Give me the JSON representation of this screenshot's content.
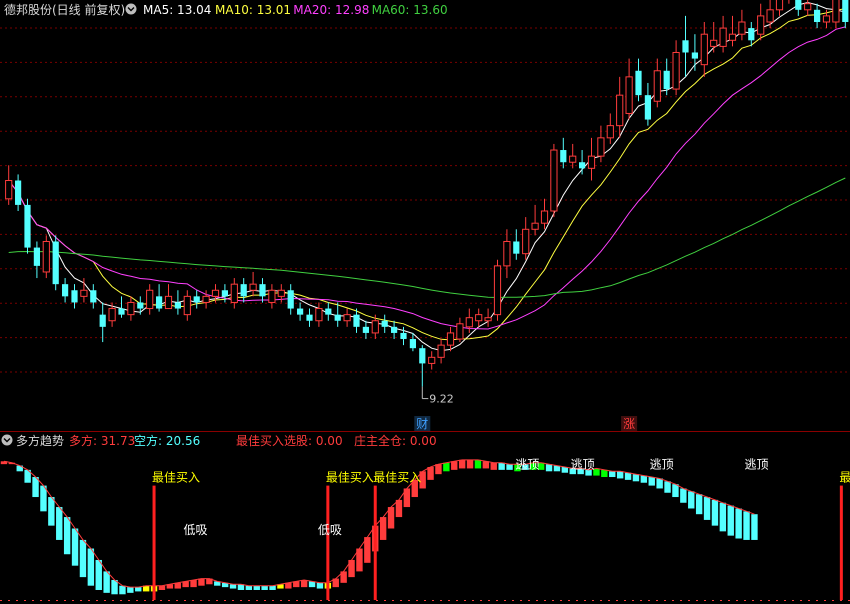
{
  "colors": {
    "bg": "#000000",
    "grid": "#7a0000",
    "up": "#ff3c3c",
    "down": "#54ffff",
    "ma5": "#ffffff",
    "ma10": "#ffff40",
    "ma20": "#ff40ff",
    "ma60": "#40d040",
    "header_text": "#d8d8d8",
    "yellow": "#ffff00",
    "green": "#00ff00"
  },
  "chart_data": [
    {
      "type": "candlestick",
      "panel": "price",
      "title": "德邦股份(日线 前复权)",
      "ma_labels": [
        {
          "name": "MA5",
          "text": "MA5: 13.04",
          "color": "#ffffff"
        },
        {
          "name": "MA10",
          "text": "MA10: 13.01",
          "color": "#ffff40"
        },
        {
          "name": "MA20",
          "text": "MA20: 12.98",
          "color": "#ff40ff"
        },
        {
          "name": "MA60",
          "text": "MA60: 13.60",
          "color": "#40d040"
        }
      ],
      "grid": true,
      "ylim": [
        9.0,
        15.2
      ],
      "low_annotation": "9.22",
      "markers": [
        {
          "text": "财",
          "index": 44,
          "color": "#3fa0ff"
        },
        {
          "text": "涨",
          "index": 66,
          "color": "#ff3c3c"
        }
      ],
      "candles": [
        [
          12.3,
          12.6,
          12.85,
          12.2
        ],
        [
          12.6,
          12.2,
          12.7,
          12.1
        ],
        [
          12.2,
          11.5,
          12.3,
          11.4
        ],
        [
          11.5,
          11.2,
          11.6,
          11.0
        ],
        [
          11.1,
          11.6,
          11.7,
          11.0
        ],
        [
          11.6,
          10.9,
          11.7,
          10.8
        ],
        [
          10.9,
          10.7,
          11.0,
          10.6
        ],
        [
          10.8,
          10.6,
          10.9,
          10.5
        ],
        [
          10.7,
          10.8,
          11.0,
          10.6
        ],
        [
          10.8,
          10.6,
          10.9,
          10.5
        ],
        [
          10.4,
          10.2,
          10.6,
          9.95
        ],
        [
          10.3,
          10.5,
          10.6,
          10.2
        ],
        [
          10.5,
          10.4,
          10.7,
          10.35
        ],
        [
          10.4,
          10.6,
          10.7,
          10.3
        ],
        [
          10.6,
          10.5,
          10.7,
          10.4
        ],
        [
          10.5,
          10.8,
          10.9,
          10.4
        ],
        [
          10.7,
          10.5,
          10.9,
          10.45
        ],
        [
          10.5,
          10.7,
          10.9,
          10.5
        ],
        [
          10.6,
          10.5,
          10.8,
          10.4
        ],
        [
          10.4,
          10.7,
          10.8,
          10.3
        ],
        [
          10.7,
          10.6,
          10.8,
          10.5
        ],
        [
          10.6,
          10.7,
          10.8,
          10.5
        ],
        [
          10.7,
          10.8,
          10.9,
          10.6
        ],
        [
          10.8,
          10.7,
          10.9,
          10.6
        ],
        [
          10.6,
          10.9,
          11.0,
          10.5
        ],
        [
          10.9,
          10.7,
          11.0,
          10.6
        ],
        [
          10.8,
          10.9,
          11.1,
          10.7
        ],
        [
          10.9,
          10.7,
          11.0,
          10.6
        ],
        [
          10.6,
          10.8,
          10.9,
          10.5
        ],
        [
          10.7,
          10.8,
          10.9,
          10.6
        ],
        [
          10.8,
          10.5,
          10.9,
          10.4
        ],
        [
          10.5,
          10.4,
          10.6,
          10.3
        ],
        [
          10.4,
          10.3,
          10.5,
          10.2
        ],
        [
          10.3,
          10.5,
          10.6,
          10.2
        ],
        [
          10.5,
          10.4,
          10.6,
          10.3
        ],
        [
          10.4,
          10.3,
          10.6,
          10.2
        ],
        [
          10.3,
          10.4,
          10.5,
          10.2
        ],
        [
          10.4,
          10.2,
          10.5,
          10.1
        ],
        [
          10.2,
          10.1,
          10.3,
          10.0
        ],
        [
          10.1,
          10.3,
          10.4,
          10.0
        ],
        [
          10.3,
          10.2,
          10.4,
          10.1
        ],
        [
          10.2,
          10.1,
          10.3,
          10.0
        ],
        [
          10.1,
          10.0,
          10.2,
          9.9
        ],
        [
          10.0,
          9.85,
          10.1,
          9.8
        ],
        [
          9.85,
          9.6,
          9.9,
          9.22
        ],
        [
          9.6,
          9.7,
          9.8,
          9.5
        ],
        [
          9.7,
          9.9,
          10.0,
          9.6
        ],
        [
          9.9,
          10.1,
          10.2,
          9.8
        ],
        [
          10.0,
          10.25,
          10.35,
          9.95
        ],
        [
          10.2,
          10.35,
          10.5,
          10.1
        ],
        [
          10.3,
          10.4,
          10.5,
          10.2
        ],
        [
          10.3,
          10.35,
          10.5,
          10.2
        ],
        [
          10.4,
          11.2,
          11.3,
          10.3
        ],
        [
          11.2,
          11.6,
          11.8,
          11.0
        ],
        [
          11.6,
          11.4,
          11.8,
          11.3
        ],
        [
          11.4,
          11.8,
          12.0,
          11.3
        ],
        [
          11.8,
          11.9,
          12.2,
          11.7
        ],
        [
          11.9,
          12.1,
          12.3,
          11.8
        ],
        [
          12.1,
          13.1,
          13.2,
          12.0
        ],
        [
          13.1,
          12.9,
          13.3,
          12.8
        ],
        [
          12.9,
          13.0,
          13.2,
          12.8
        ],
        [
          12.9,
          12.8,
          13.1,
          12.7
        ],
        [
          12.8,
          13.0,
          13.3,
          12.6
        ],
        [
          13.0,
          13.3,
          13.5,
          12.9
        ],
        [
          13.3,
          13.5,
          13.7,
          13.2
        ],
        [
          13.5,
          14.0,
          14.3,
          13.3
        ],
        [
          13.7,
          14.3,
          14.6,
          13.6
        ],
        [
          14.4,
          14.0,
          14.6,
          13.9
        ],
        [
          14.0,
          13.6,
          14.2,
          13.5
        ],
        [
          13.9,
          14.4,
          14.6,
          13.8
        ],
        [
          14.4,
          14.1,
          14.6,
          14.0
        ],
        [
          14.1,
          14.7,
          14.9,
          14.0
        ],
        [
          14.9,
          14.7,
          15.3,
          14.3
        ],
        [
          14.7,
          14.6,
          15.0,
          14.4
        ],
        [
          14.5,
          15.0,
          15.2,
          14.3
        ],
        [
          14.8,
          14.9,
          15.2,
          14.7
        ],
        [
          14.8,
          15.1,
          15.3,
          14.7
        ],
        [
          14.9,
          15.0,
          15.3,
          14.8
        ],
        [
          15.0,
          15.2,
          15.4,
          14.9
        ],
        [
          15.1,
          14.9,
          15.2,
          14.8
        ],
        [
          15.0,
          15.3,
          15.5,
          14.9
        ],
        [
          15.2,
          15.4,
          15.7,
          15.1
        ],
        [
          15.4,
          15.6,
          15.8,
          15.3
        ],
        [
          15.6,
          15.7,
          15.9,
          15.5
        ],
        [
          15.7,
          15.4,
          15.8,
          15.3
        ],
        [
          15.4,
          15.5,
          15.7,
          15.3
        ],
        [
          15.4,
          15.2,
          15.5,
          15.1
        ],
        [
          15.2,
          15.3,
          15.4,
          15.1
        ],
        [
          15.2,
          15.6,
          15.7,
          15.1
        ],
        [
          15.6,
          15.2,
          15.7,
          15.1
        ]
      ]
    },
    {
      "type": "bar",
      "panel": "indicator",
      "title": "多方趋势",
      "labels": [
        {
          "name": "多方",
          "text": "多方: 31.73",
          "color": "#ff3c3c"
        },
        {
          "name": "空方",
          "text": "空方: 20.56",
          "color": "#54ffff"
        },
        {
          "name": "最佳买入选股",
          "text": "最佳买入选股: 0.00",
          "color": "#ff3c3c"
        },
        {
          "name": "庄主全仓",
          "text": "庄主全仓: 0.00",
          "color": "#ff3c3c"
        }
      ],
      "ylim": [
        0,
        100
      ],
      "bars": [
        [
          95,
          97,
          "up"
        ],
        [
          95,
          96,
          "up"
        ],
        [
          90,
          94,
          "down"
        ],
        [
          82,
          91,
          "down"
        ],
        [
          72,
          86,
          "down"
        ],
        [
          62,
          80,
          "down"
        ],
        [
          52,
          72,
          "down"
        ],
        [
          42,
          65,
          "down"
        ],
        [
          32,
          58,
          "down"
        ],
        [
          24,
          50,
          "down"
        ],
        [
          16,
          42,
          "down"
        ],
        [
          10,
          36,
          "down"
        ],
        [
          7,
          28,
          "down"
        ],
        [
          5,
          20,
          "down"
        ],
        [
          4,
          14,
          "down"
        ],
        [
          4,
          10,
          "down"
        ],
        [
          5,
          9,
          "down"
        ],
        [
          6,
          9,
          "down"
        ],
        [
          6,
          10,
          "yellow"
        ],
        [
          6,
          10,
          "yellow"
        ],
        [
          7,
          10,
          "up"
        ],
        [
          8,
          11,
          "up"
        ],
        [
          8,
          12,
          "up"
        ],
        [
          9,
          13,
          "up"
        ],
        [
          9,
          14,
          "up"
        ],
        [
          10,
          15,
          "up"
        ],
        [
          11,
          15,
          "up"
        ],
        [
          10,
          13,
          "down"
        ],
        [
          9,
          12,
          "down"
        ],
        [
          8,
          11,
          "down"
        ],
        [
          7,
          11,
          "down"
        ],
        [
          7,
          10,
          "down"
        ],
        [
          7,
          10,
          "down"
        ],
        [
          7,
          10,
          "down"
        ],
        [
          7,
          10,
          "down"
        ],
        [
          8,
          11,
          "yellow"
        ],
        [
          8,
          12,
          "up"
        ],
        [
          9,
          13,
          "up"
        ],
        [
          9,
          14,
          "up"
        ],
        [
          9,
          13,
          "down"
        ],
        [
          8,
          12,
          "down"
        ],
        [
          8,
          12,
          "yellow"
        ],
        [
          9,
          15,
          "up"
        ],
        [
          12,
          20,
          "up"
        ],
        [
          16,
          28,
          "up"
        ],
        [
          20,
          36,
          "up"
        ],
        [
          26,
          44,
          "up"
        ],
        [
          34,
          52,
          "up"
        ],
        [
          42,
          58,
          "up"
        ],
        [
          50,
          65,
          "up"
        ],
        [
          58,
          70,
          "up"
        ],
        [
          65,
          78,
          "up"
        ],
        [
          72,
          84,
          "up"
        ],
        [
          78,
          90,
          "up"
        ],
        [
          84,
          93,
          "up"
        ],
        [
          88,
          95,
          "up"
        ],
        [
          90,
          96,
          "green"
        ],
        [
          91,
          97,
          "up"
        ],
        [
          92,
          98,
          "up"
        ],
        [
          92,
          98,
          "up"
        ],
        [
          92,
          98,
          "green"
        ],
        [
          92,
          97,
          "up"
        ],
        [
          91,
          96,
          "up"
        ],
        [
          91,
          96,
          "down"
        ],
        [
          91,
          95,
          "down"
        ],
        [
          90,
          95,
          "green"
        ],
        [
          91,
          95,
          "down"
        ],
        [
          91,
          96,
          "green"
        ],
        [
          91,
          96,
          "green"
        ],
        [
          90,
          95,
          "down"
        ],
        [
          90,
          94,
          "down"
        ],
        [
          89,
          93,
          "down"
        ],
        [
          88,
          92,
          "down"
        ],
        [
          88,
          92,
          "down"
        ],
        [
          87,
          91,
          "down"
        ],
        [
          87,
          92,
          "green"
        ],
        [
          86,
          91,
          "green"
        ],
        [
          86,
          90,
          "down"
        ],
        [
          85,
          90,
          "down"
        ],
        [
          84,
          89,
          "down"
        ],
        [
          83,
          88,
          "down"
        ],
        [
          82,
          87,
          "down"
        ],
        [
          80,
          86,
          "down"
        ],
        [
          78,
          85,
          "down"
        ],
        [
          75,
          83,
          "down"
        ],
        [
          72,
          81,
          "down"
        ],
        [
          68,
          78,
          "down"
        ],
        [
          64,
          76,
          "down"
        ],
        [
          60,
          74,
          "down"
        ],
        [
          56,
          72,
          "down"
        ],
        [
          52,
          70,
          "down"
        ],
        [
          48,
          68,
          "down"
        ],
        [
          45,
          66,
          "down"
        ],
        [
          43,
          64,
          "down"
        ],
        [
          42,
          62,
          "down"
        ],
        [
          42,
          60,
          "down"
        ]
      ],
      "signals": [
        {
          "index": 19,
          "label": "最佳买入",
          "top": 80
        },
        {
          "index": 41,
          "label": "最佳买入",
          "top": 80
        },
        {
          "index": 47,
          "label": "最佳买入",
          "top": 80
        },
        {
          "index": 106,
          "label": "最佳",
          "top": 80
        }
      ],
      "annotations": [
        {
          "text": "低吸",
          "index": 24,
          "value": 46,
          "color": "#ffffff"
        },
        {
          "text": "低吸",
          "index": 41,
          "value": 46,
          "color": "#ffffff"
        },
        {
          "text": "逃顶",
          "index": 66,
          "value": 92,
          "color": "#ffffff"
        },
        {
          "text": "逃顶",
          "index": 73,
          "value": 92,
          "color": "#ffffff"
        },
        {
          "text": "逃顶",
          "index": 83,
          "value": 92,
          "color": "#ffffff"
        },
        {
          "text": "逃顶",
          "index": 95,
          "value": 92,
          "color": "#ffffff"
        }
      ],
      "signal_color": "#ffff00"
    }
  ]
}
